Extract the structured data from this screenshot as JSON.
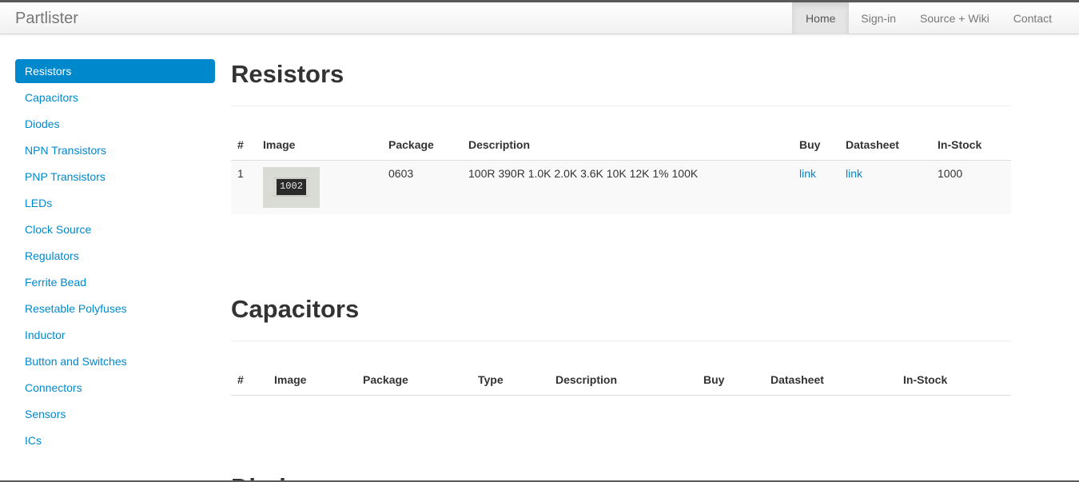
{
  "navbar": {
    "brand": "Partlister",
    "items": [
      {
        "label": "Home",
        "active": true
      },
      {
        "label": "Sign-in"
      },
      {
        "label": "Source + Wiki"
      },
      {
        "label": "Contact"
      }
    ]
  },
  "sidebar": {
    "items": [
      {
        "label": "Resistors",
        "active": true
      },
      {
        "label": "Capacitors"
      },
      {
        "label": "Diodes"
      },
      {
        "label": "NPN Transistors"
      },
      {
        "label": "PNP Transistors"
      },
      {
        "label": "LEDs"
      },
      {
        "label": "Clock Source"
      },
      {
        "label": "Regulators"
      },
      {
        "label": "Ferrite Bead"
      },
      {
        "label": "Resetable Polyfuses"
      },
      {
        "label": "Inductor"
      },
      {
        "label": "Button and Switches"
      },
      {
        "label": "Connectors"
      },
      {
        "label": "Sensors"
      },
      {
        "label": "ICs"
      }
    ]
  },
  "resistors": {
    "title": "Resistors",
    "headers": [
      "#",
      "Image",
      "Package",
      "Description",
      "Buy",
      "Datasheet",
      "In-Stock"
    ],
    "rows": [
      {
        "num": "1",
        "image_label": "1002",
        "package": "0603",
        "description": "100R 390R 1.0K 2.0K 3.6K 10K 12K 1% 100K",
        "buy": "link",
        "datasheet": "link",
        "in_stock": "1000"
      }
    ]
  },
  "capacitors": {
    "title": "Capacitors",
    "headers": [
      "#",
      "Image",
      "Package",
      "Type",
      "Description",
      "Buy",
      "Datasheet",
      "In-Stock"
    ]
  },
  "diodes": {
    "title": "Diodes"
  },
  "colors": {
    "accent": "#0088cc",
    "text": "#333333",
    "nav_text": "#777777"
  }
}
